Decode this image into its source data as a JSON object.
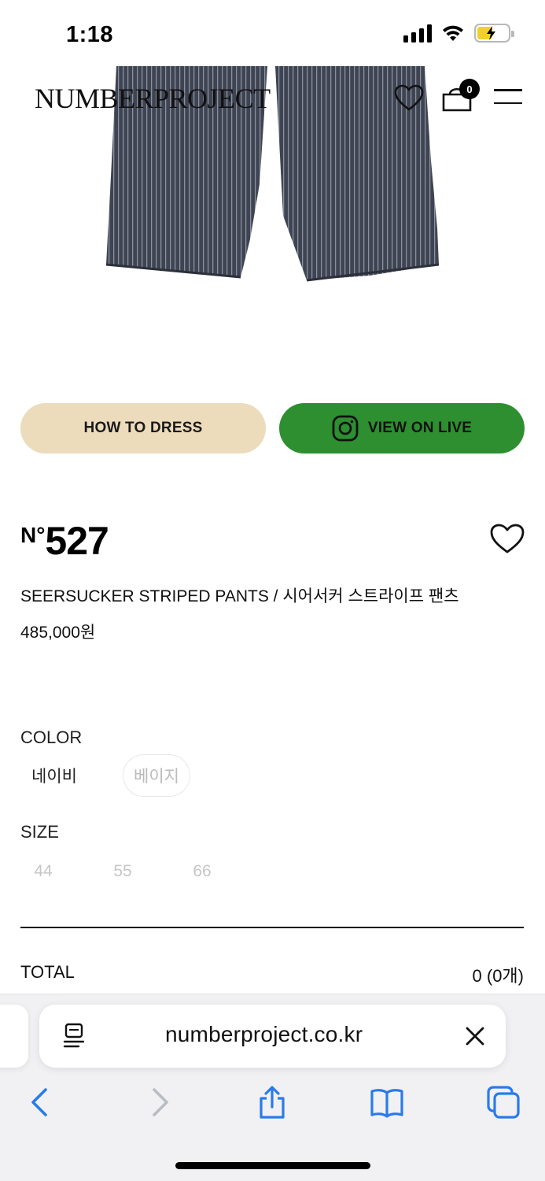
{
  "status_bar": {
    "time": "1:18",
    "icons": [
      "signal-icon",
      "wifi-icon",
      "battery-charging-icon"
    ],
    "battery_level": 0.5
  },
  "header": {
    "logo": "NUMBERPROJECT",
    "cart_count": "0",
    "icons": [
      "heart-icon",
      "cart-icon",
      "menu-icon"
    ]
  },
  "actions": {
    "how_to_dress": "HOW TO DRESS",
    "view_on_live": "VIEW ON LIVE",
    "colors": {
      "how_to_dress_bg": "#ecdcbc",
      "view_on_live_bg": "#2d8f30"
    }
  },
  "product": {
    "number_prefix": "N°",
    "number": "527",
    "name": "SEERSUCKER STRIPED PANTS / 시어서커 스트라이프 팬츠",
    "price": "485,000원"
  },
  "options": {
    "color_label": "COLOR",
    "colors": [
      {
        "label": "네이비",
        "available": true
      },
      {
        "label": "베이지",
        "available": false
      }
    ],
    "size_label": "SIZE",
    "sizes": [
      "44",
      "55",
      "66"
    ]
  },
  "total": {
    "label": "TOTAL",
    "value": "0 (0개)"
  },
  "browser": {
    "url": "numberproject.co.kr",
    "toolbar_icons": [
      "back-icon",
      "forward-icon",
      "share-icon",
      "bookmarks-icon",
      "tabs-icon"
    ]
  }
}
